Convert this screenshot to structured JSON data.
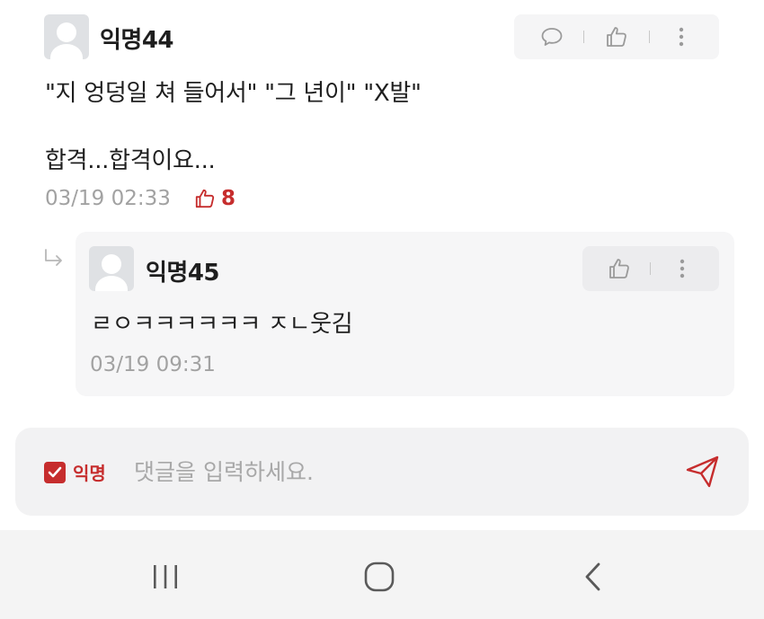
{
  "comment": {
    "avatar_icon": "default-user-avatar",
    "nickname": "익명44",
    "line1": "\"지 엉덩일 쳐 들어서\" \"그 년이\" \"X발\"",
    "line2": "합격...합격이요...",
    "timestamp": "03/19 02:33",
    "like_count": "8",
    "actions": [
      "reply-icon",
      "thumbs-up-icon",
      "more-vertical-icon"
    ]
  },
  "reply": {
    "avatar_icon": "default-user-avatar",
    "nickname": "익명45",
    "text": "ㄹㅇㅋㅋㅋㅋㅋㅋ ㅈㄴ웃김",
    "timestamp": "03/19 09:31",
    "actions": [
      "thumbs-up-icon",
      "more-vertical-icon"
    ]
  },
  "composer": {
    "anonymous_label": "익명",
    "anonymous_checked": true,
    "placeholder": "댓글을 입력하세요.",
    "value": ""
  },
  "navbar": {
    "buttons": [
      "recent-apps-icon",
      "home-icon",
      "back-icon"
    ]
  },
  "colors": {
    "accent": "#c62d2d",
    "meta_gray": "#a2a2a2",
    "panel_bg": "#f5f5f6"
  }
}
